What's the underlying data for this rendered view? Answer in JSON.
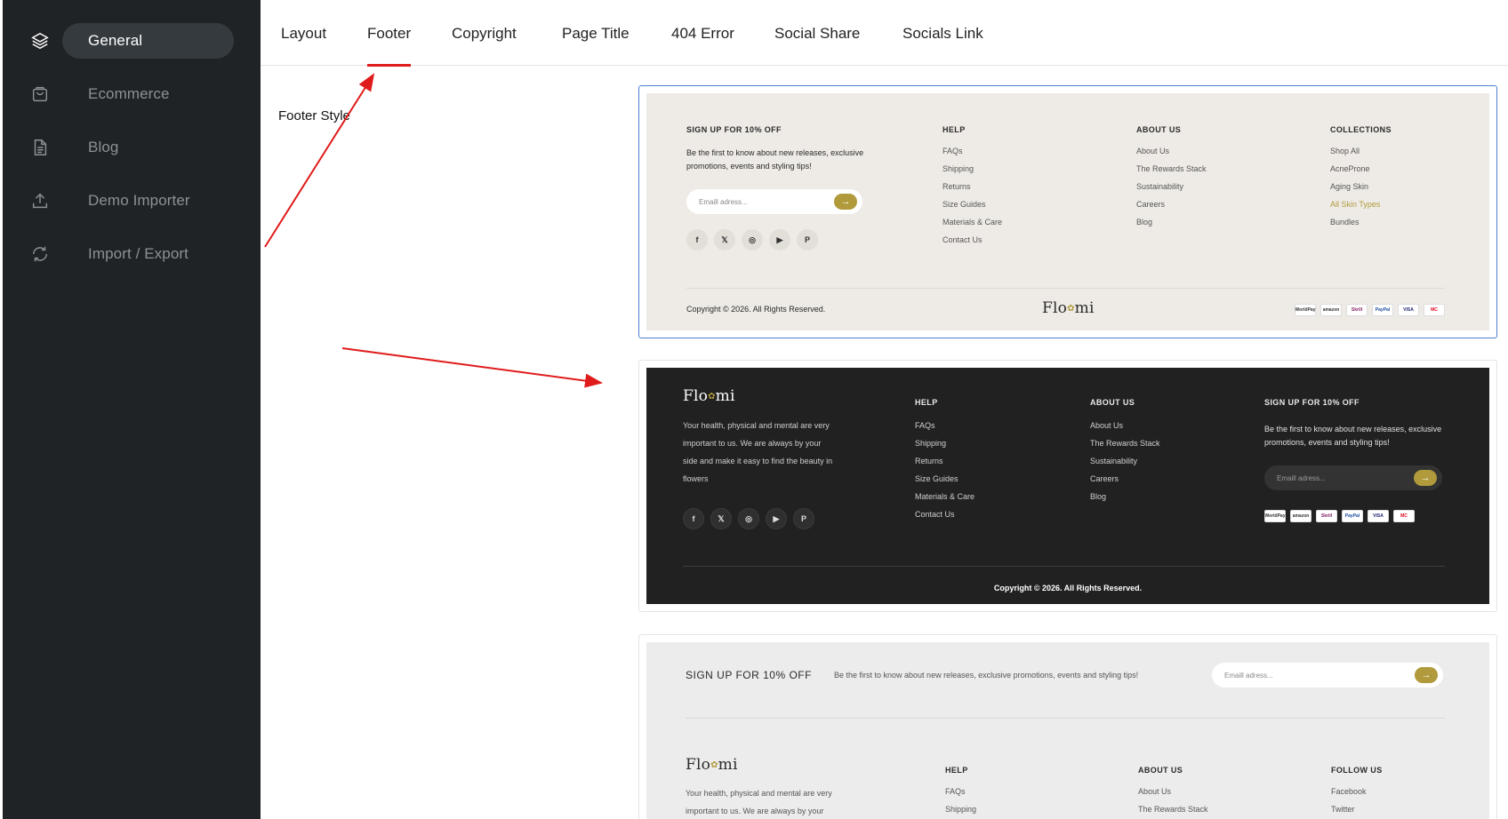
{
  "sidebar": {
    "items": [
      {
        "label": "General",
        "icon": "layers-icon",
        "active": true
      },
      {
        "label": "Ecommerce",
        "icon": "bag-icon"
      },
      {
        "label": "Blog",
        "icon": "document-icon"
      },
      {
        "label": "Demo Importer",
        "icon": "upload-icon"
      },
      {
        "label": "Import / Export",
        "icon": "sync-icon"
      }
    ]
  },
  "tabs": [
    {
      "label": "Layout"
    },
    {
      "label": "Footer",
      "active": true
    },
    {
      "label": "Copyright"
    },
    {
      "label": "Page Title"
    },
    {
      "label": "404 Error"
    },
    {
      "label": "Social Share"
    },
    {
      "label": "Socials Link"
    }
  ],
  "field": {
    "label": "Footer Style"
  },
  "footer1": {
    "signup_title": "SIGN UP FOR 10% OFF",
    "signup_text": "Be the first to know about new releases, exclusive promotions, events and styling tips!",
    "email_placeholder": "Emaill adress...",
    "arrow": "→",
    "social": [
      "f",
      "𝕏",
      "◎",
      "▶",
      "P"
    ],
    "help": {
      "title": "HELP",
      "links": [
        "FAQs",
        "Shipping",
        "Returns",
        "Size Guides",
        "Materials & Care",
        "Contact Us"
      ]
    },
    "about": {
      "title": "ABOUT US",
      "links": [
        "About Us",
        "The Rewards Stack",
        "Sustainability",
        "Careers",
        "Blog"
      ]
    },
    "collections": {
      "title": "COLLECTIONS",
      "links": [
        "Shop All",
        "AcneProne",
        "Aging Skin",
        "All Skin Types",
        "Bundles"
      ]
    },
    "copyright": "Copyright © 2026. All Rights Reserved.",
    "logo_a": "Flo",
    "logo_dot": "✿",
    "logo_b": "mi",
    "payments": [
      "WorldPay",
      "amazon",
      "Skrill",
      "PayPal",
      "VISA",
      "MC"
    ]
  },
  "footer2": {
    "logo_a": "Flo",
    "logo_dot": "✿",
    "logo_b": "mi",
    "about_text": "Your health, physical and mental are very important to us. We are always by your side and make it easy to find the beauty in flowers",
    "social": [
      "f",
      "𝕏",
      "◎",
      "▶",
      "P"
    ],
    "help": {
      "title": "HELP",
      "links": [
        "FAQs",
        "Shipping",
        "Returns",
        "Size Guides",
        "Materials & Care",
        "Contact Us"
      ]
    },
    "about": {
      "title": "ABOUT US",
      "links": [
        "About Us",
        "The Rewards Stack",
        "Sustainability",
        "Careers",
        "Blog"
      ]
    },
    "signup_title": "SIGN UP FOR 10% OFF",
    "signup_text": "Be the first to know about new releases, exclusive promotions, events and styling tips!",
    "email_placeholder": "Emaill adress...",
    "arrow": "→",
    "payments": [
      "WorldPay",
      "amazon",
      "Skrill",
      "PayPal",
      "VISA",
      "MC"
    ],
    "copyright": "Copyright © 2026. All Rights Reserved."
  },
  "footer3": {
    "signup_title": "SIGN UP FOR 10% OFF",
    "signup_text": "Be the first to know about new releases, exclusive promotions, events and styling tips!",
    "email_placeholder": "Emaill adress...",
    "arrow": "→",
    "logo_a": "Flo",
    "logo_dot": "✿",
    "logo_b": "mi",
    "about_text": "Your health, physical and mental are very important to us. We are always by your",
    "help": {
      "title": "HELP",
      "links": [
        "FAQs",
        "Shipping"
      ]
    },
    "about": {
      "title": "ABOUT US",
      "links": [
        "About Us",
        "The Rewards Stack"
      ]
    },
    "follow": {
      "title": "FOLLOW US",
      "links": [
        "Facebook",
        "Twitter"
      ]
    }
  },
  "colors": {
    "accent": "#e01b1b",
    "gold": "#b19a3b",
    "sidebar": "#1f2326",
    "selected_border": "#4f7fcf"
  }
}
